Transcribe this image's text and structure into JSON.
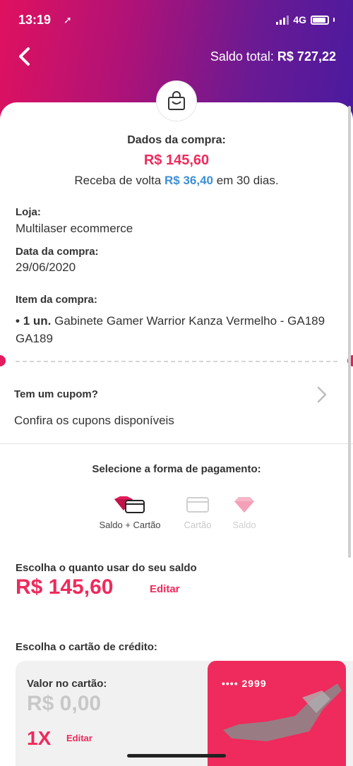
{
  "status_bar": {
    "time": "13:19",
    "network": "4G"
  },
  "header": {
    "saldo_label": "Saldo total:",
    "saldo_value": "R$ 727,22"
  },
  "purchase": {
    "title": "Dados da compra:",
    "value": "R$ 145,60",
    "cashback_prefix": "Receba de volta",
    "cashback_value": "R$ 36,40",
    "cashback_suffix": "em 30 dias."
  },
  "store": {
    "label": "Loja:",
    "value": "Multilaser ecommerce"
  },
  "purchase_date": {
    "label": "Data da compra:",
    "value": "29/06/2020"
  },
  "item": {
    "label": "Item da compra:",
    "quantity": "1 un.",
    "description": "Gabinete Gamer Warrior Kanza Vermelho - GA189 GA189"
  },
  "coupon": {
    "title": "Tem um cupom?",
    "subtitle": "Confira os cupons disponíveis"
  },
  "payment": {
    "title": "Selecione a forma de pagamento:",
    "options": [
      {
        "label": "Saldo + Cartão",
        "icon": "balance-card-icon",
        "selected": true
      },
      {
        "label": "Cartão",
        "icon": "credit-card-icon",
        "selected": false
      },
      {
        "label": "Saldo",
        "icon": "diamond-icon",
        "selected": false
      }
    ]
  },
  "saldo_use": {
    "title": "Escolha o quanto usar do seu saldo",
    "value": "R$ 145,60",
    "edit_label": "Editar"
  },
  "credit_card": {
    "title": "Escolha o cartão de crédito:",
    "value_label": "Valor no cartão:",
    "value": "R$ 0,00",
    "installments": "1X",
    "installments_edit": "Editar",
    "card_number": "•••• 2999"
  },
  "colors": {
    "accent": "#ef2a5c",
    "cashback": "#3d8fd6",
    "header_start": "#e0115f",
    "header_end": "#4a1aa0"
  }
}
